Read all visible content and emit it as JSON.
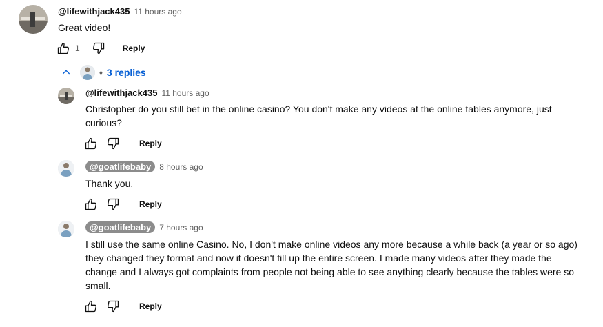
{
  "colors": {
    "link": "#065fd4",
    "owner_badge_bg": "#8c8c8c",
    "meta": "#606060"
  },
  "icons": {
    "like": "thumb-up-icon",
    "dislike": "thumb-down-icon",
    "collapse": "chevron-up-icon"
  },
  "top_comment": {
    "author": "@lifewithjack435",
    "time": "11 hours ago",
    "text": "Great video!",
    "likes": "1",
    "reply_label": "Reply"
  },
  "replies_toggle": {
    "bullet": "•",
    "label": "3 replies"
  },
  "replies": [
    {
      "author": "@lifewithjack435",
      "owner": false,
      "time": "11 hours ago",
      "text": "Christopher do you still bet in the online casino? You don't make any videos at the online tables anymore, just curious?",
      "reply_label": "Reply"
    },
    {
      "author": "@goatlifebaby",
      "owner": true,
      "time": "8 hours ago",
      "text": "Thank you.",
      "reply_label": "Reply"
    },
    {
      "author": "@goatlifebaby",
      "owner": true,
      "time": "7 hours ago",
      "text": "I still use the same online Casino. No, I don't make online videos any more because a while back (a year or so ago) they changed they format and now it doesn't fill up the entire screen. I made many videos after they made the change and I always got complaints from people not being able to see anything clearly because the tables were so small.",
      "reply_label": "Reply"
    }
  ]
}
